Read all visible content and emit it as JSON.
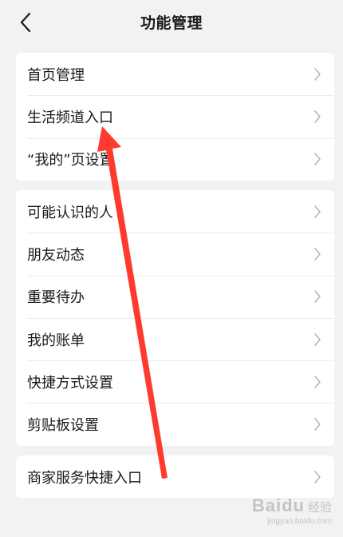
{
  "header": {
    "title": "功能管理",
    "back_icon": "chevron-left-icon"
  },
  "group1": [
    {
      "label": "首页管理"
    },
    {
      "label": "生活频道入口"
    },
    {
      "label": "“我的”页设置"
    }
  ],
  "group2": [
    {
      "label": "可能认识的人"
    },
    {
      "label": "朋友动态"
    },
    {
      "label": "重要待办"
    },
    {
      "label": "我的账单"
    },
    {
      "label": "快捷方式设置"
    },
    {
      "label": "剪贴板设置"
    }
  ],
  "group3": [
    {
      "label": "商家服务快捷入口"
    }
  ],
  "row_icon": "chevron-right-icon",
  "annotation": {
    "color": "#ff3b30",
    "icon": "red-arrow-icon"
  },
  "watermark": {
    "brand": "Baidu",
    "cn": "经验",
    "url": "jingyan.baidu.com"
  }
}
